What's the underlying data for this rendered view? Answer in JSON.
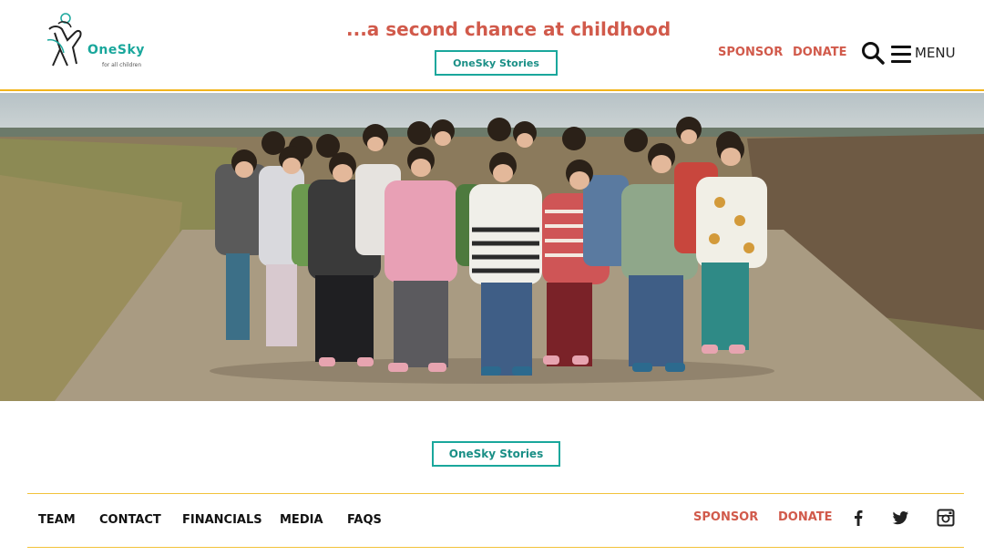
{
  "header": {
    "logo": {
      "name": "OneSky",
      "sub": "for all children"
    },
    "tagline": "...a second chance at childhood",
    "stories_button": "OneSky Stories",
    "nav": {
      "sponsor": "SPONSOR",
      "donate": "DONATE",
      "menu": "MENU"
    },
    "icons": {
      "search": "search-icon",
      "menu": "hamburger-icon"
    }
  },
  "hero": {
    "alt": "hero-photo-children"
  },
  "main": {
    "stories_button": "OneSky Stories"
  },
  "footer": {
    "links": [
      "TEAM",
      "CONTACT",
      "FINANCIALS",
      "MEDIA",
      "FAQS"
    ],
    "sponsor": "SPONSOR",
    "donate": "DONATE",
    "social": [
      "facebook-icon",
      "twitter-icon",
      "instagram-icon"
    ]
  },
  "colors": {
    "accent": "#d15a4b",
    "teal": "#1aa79c",
    "rule": "#f2b51c"
  }
}
